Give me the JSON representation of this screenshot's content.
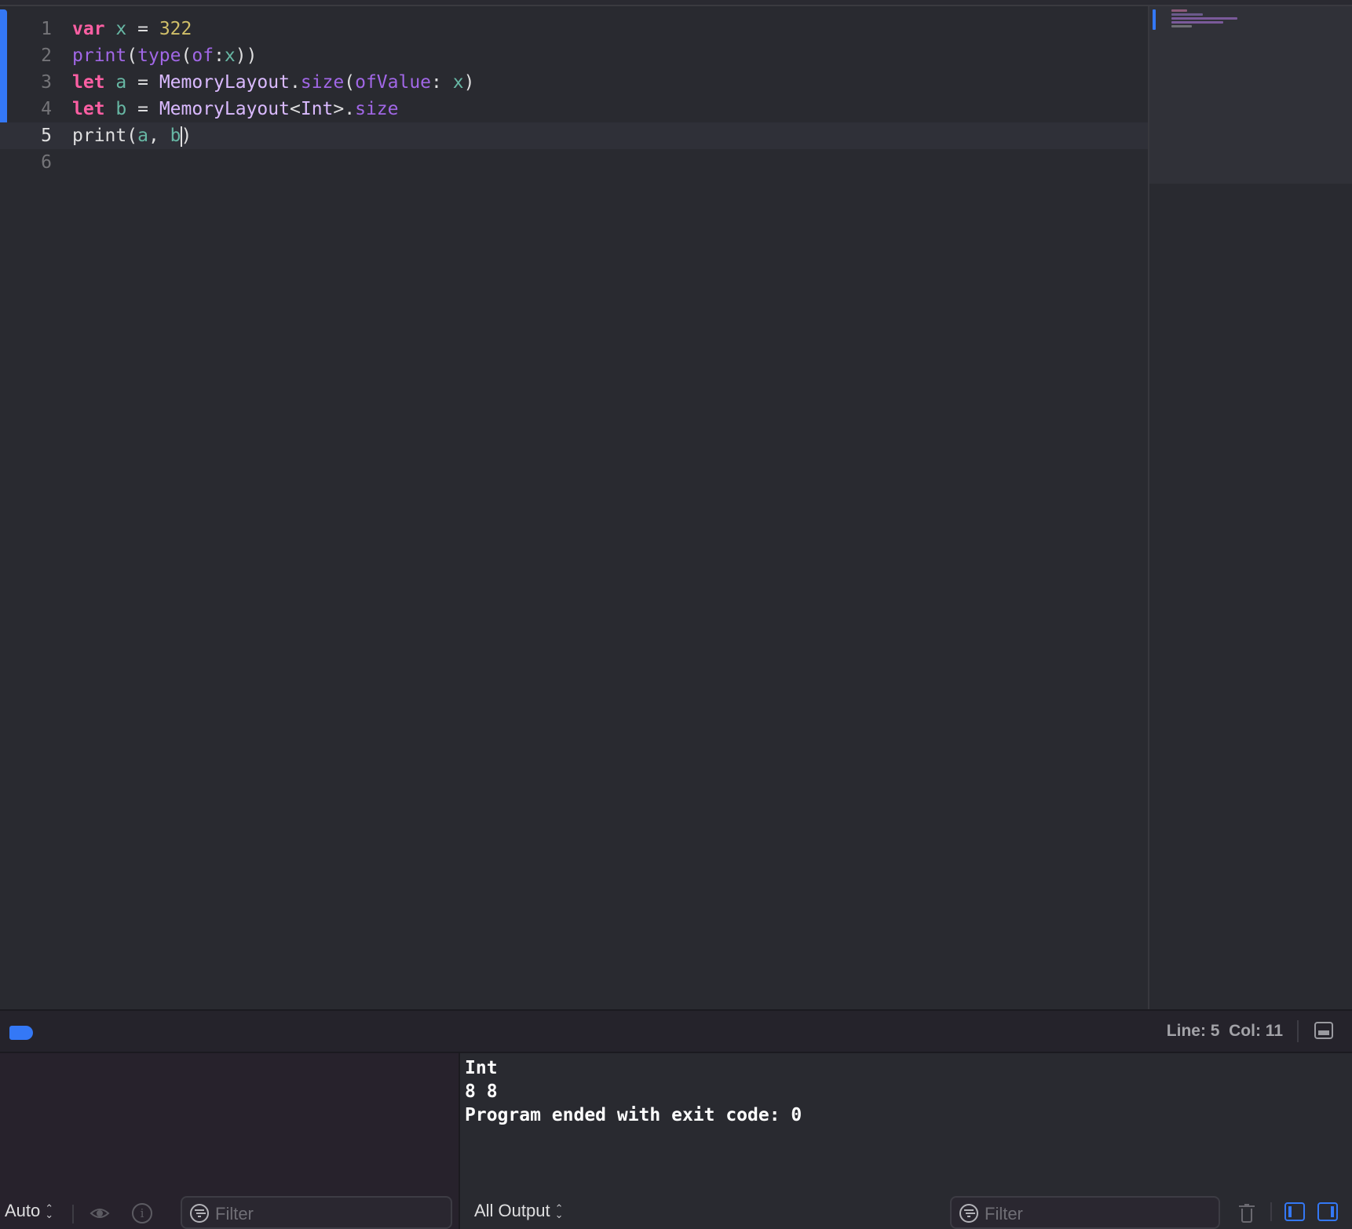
{
  "editor": {
    "lines": [
      {
        "number": "1",
        "tokens": [
          {
            "t": "var",
            "c": "kw"
          },
          {
            "t": " ",
            "c": "plain"
          },
          {
            "t": "x",
            "c": "var"
          },
          {
            "t": " = ",
            "c": "plain"
          },
          {
            "t": "322",
            "c": "num"
          }
        ]
      },
      {
        "number": "2",
        "tokens": [
          {
            "t": "print",
            "c": "fn"
          },
          {
            "t": "(",
            "c": "plain"
          },
          {
            "t": "type",
            "c": "fn"
          },
          {
            "t": "(",
            "c": "plain"
          },
          {
            "t": "of",
            "c": "fn"
          },
          {
            "t": ":",
            "c": "plain"
          },
          {
            "t": "x",
            "c": "var"
          },
          {
            "t": "))",
            "c": "plain"
          }
        ]
      },
      {
        "number": "3",
        "tokens": [
          {
            "t": "let",
            "c": "kw"
          },
          {
            "t": " ",
            "c": "plain"
          },
          {
            "t": "a",
            "c": "var"
          },
          {
            "t": " = ",
            "c": "plain"
          },
          {
            "t": "MemoryLayout",
            "c": "cls"
          },
          {
            "t": ".",
            "c": "plain"
          },
          {
            "t": "size",
            "c": "fn"
          },
          {
            "t": "(",
            "c": "plain"
          },
          {
            "t": "ofValue",
            "c": "fn"
          },
          {
            "t": ": ",
            "c": "plain"
          },
          {
            "t": "x",
            "c": "var"
          },
          {
            "t": ")",
            "c": "plain"
          }
        ]
      },
      {
        "number": "4",
        "tokens": [
          {
            "t": "let",
            "c": "kw"
          },
          {
            "t": " ",
            "c": "plain"
          },
          {
            "t": "b",
            "c": "var"
          },
          {
            "t": " = ",
            "c": "plain"
          },
          {
            "t": "MemoryLayout",
            "c": "cls"
          },
          {
            "t": "<",
            "c": "plain"
          },
          {
            "t": "Int",
            "c": "cls"
          },
          {
            "t": ">.",
            "c": "plain"
          },
          {
            "t": "size",
            "c": "fn"
          }
        ]
      },
      {
        "number": "5",
        "tokens": [
          {
            "t": "print",
            "c": "plain"
          },
          {
            "t": "(",
            "c": "plain"
          },
          {
            "t": "a",
            "c": "var"
          },
          {
            "t": ", ",
            "c": "plain"
          },
          {
            "t": "b",
            "c": "var"
          },
          {
            "t": "|caret|",
            "c": "caret"
          },
          {
            "t": ")",
            "c": "plain"
          }
        ],
        "current": true
      },
      {
        "number": "6",
        "tokens": []
      }
    ]
  },
  "status": {
    "line_label": "Line: 5",
    "col_label": "Col: 11"
  },
  "debug": {
    "variables_toolbar": {
      "scope_select": "Auto",
      "filter_placeholder": "Filter"
    },
    "console": {
      "output_lines": [
        "Int",
        "8 8",
        "Program ended with exit code: 0"
      ],
      "output_select": "All Output",
      "filter_placeholder": "Filter"
    }
  },
  "colors": {
    "accent": "#3478f6",
    "keyword": "#fc5fa3",
    "variable": "#67b7a4",
    "number": "#d0bf69",
    "function": "#a167e6",
    "class": "#dabaff",
    "background": "#292a30"
  }
}
